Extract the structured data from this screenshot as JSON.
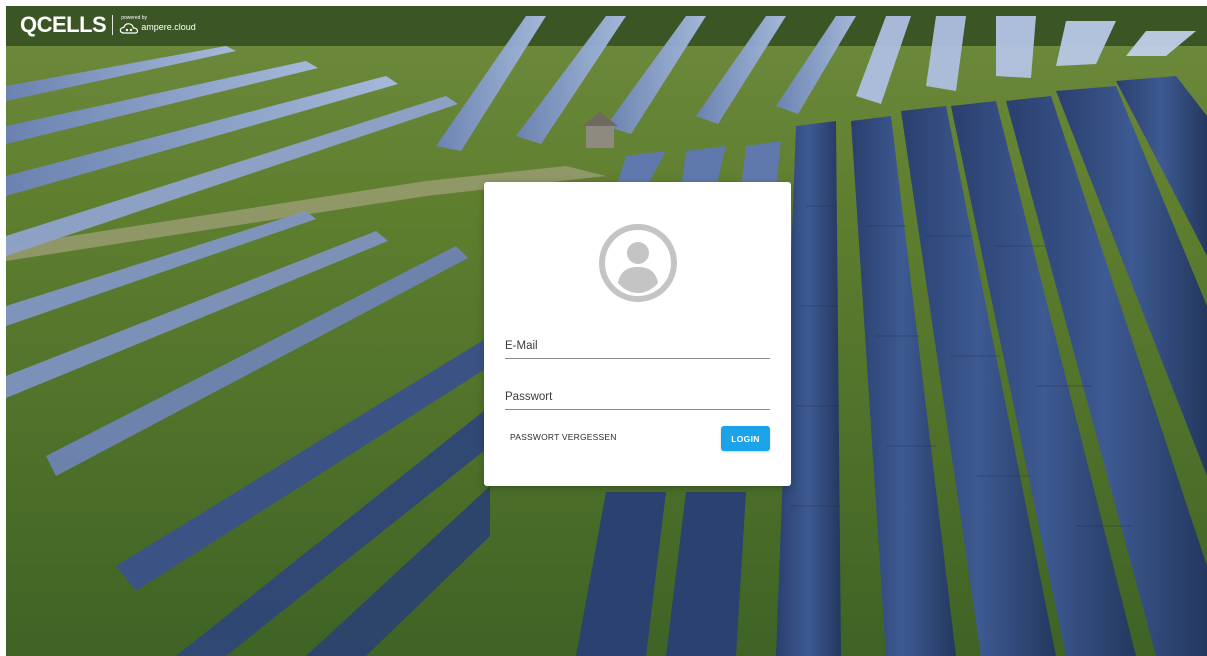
{
  "brand": {
    "logo_text": "QCELLS",
    "powered_by": "powered by",
    "partner_name": "ampere.cloud",
    "partner_icon": "cloud-icon"
  },
  "login": {
    "avatar_icon": "user-avatar-icon",
    "email_placeholder": "E-Mail",
    "email_value": "",
    "password_placeholder": "Passwort",
    "password_value": "",
    "forgot_label": "PASSWORT VERGESSEN",
    "login_label": "LOGIN"
  },
  "colors": {
    "accent": "#1aa3e8",
    "card_background": "#ffffff",
    "avatar_gray": "#c4c4c4"
  }
}
